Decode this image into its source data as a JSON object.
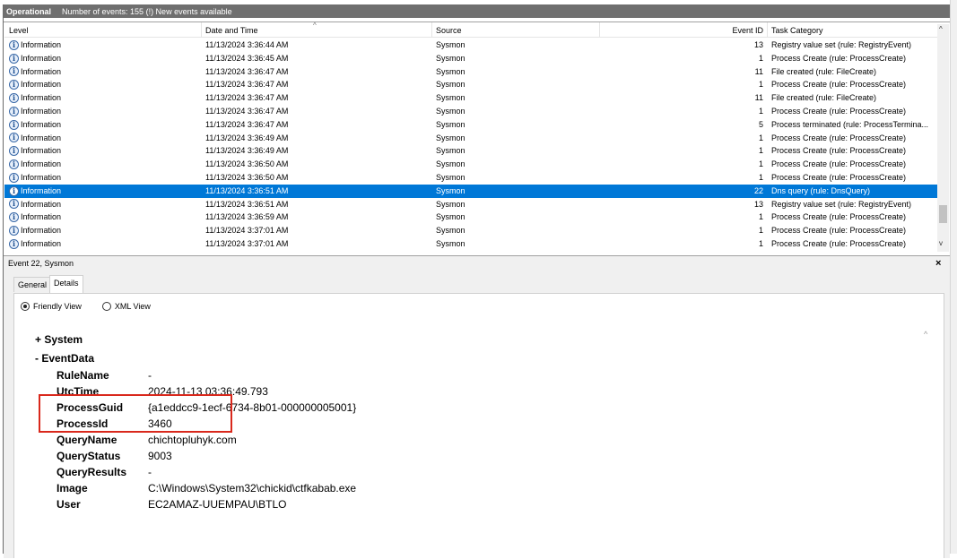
{
  "log_header": {
    "name": "Operational",
    "info": "Number of events: 155 (!) New events available"
  },
  "columns": [
    "Level",
    "Date and Time",
    "Source",
    "Event ID",
    "Task Category"
  ],
  "events": [
    {
      "level": "Information",
      "datetime": "11/13/2024 3:36:44 AM",
      "source": "Sysmon",
      "id": "13",
      "task": "Registry value set (rule: RegistryEvent)"
    },
    {
      "level": "Information",
      "datetime": "11/13/2024 3:36:45 AM",
      "source": "Sysmon",
      "id": "1",
      "task": "Process Create (rule: ProcessCreate)"
    },
    {
      "level": "Information",
      "datetime": "11/13/2024 3:36:47 AM",
      "source": "Sysmon",
      "id": "11",
      "task": "File created (rule: FileCreate)"
    },
    {
      "level": "Information",
      "datetime": "11/13/2024 3:36:47 AM",
      "source": "Sysmon",
      "id": "1",
      "task": "Process Create (rule: ProcessCreate)"
    },
    {
      "level": "Information",
      "datetime": "11/13/2024 3:36:47 AM",
      "source": "Sysmon",
      "id": "11",
      "task": "File created (rule: FileCreate)"
    },
    {
      "level": "Information",
      "datetime": "11/13/2024 3:36:47 AM",
      "source": "Sysmon",
      "id": "1",
      "task": "Process Create (rule: ProcessCreate)"
    },
    {
      "level": "Information",
      "datetime": "11/13/2024 3:36:47 AM",
      "source": "Sysmon",
      "id": "5",
      "task": "Process terminated (rule: ProcessTermina..."
    },
    {
      "level": "Information",
      "datetime": "11/13/2024 3:36:49 AM",
      "source": "Sysmon",
      "id": "1",
      "task": "Process Create (rule: ProcessCreate)"
    },
    {
      "level": "Information",
      "datetime": "11/13/2024 3:36:49 AM",
      "source": "Sysmon",
      "id": "1",
      "task": "Process Create (rule: ProcessCreate)"
    },
    {
      "level": "Information",
      "datetime": "11/13/2024 3:36:50 AM",
      "source": "Sysmon",
      "id": "1",
      "task": "Process Create (rule: ProcessCreate)"
    },
    {
      "level": "Information",
      "datetime": "11/13/2024 3:36:50 AM",
      "source": "Sysmon",
      "id": "1",
      "task": "Process Create (rule: ProcessCreate)"
    },
    {
      "level": "Information",
      "datetime": "11/13/2024 3:36:51 AM",
      "source": "Sysmon",
      "id": "22",
      "task": "Dns query (rule: DnsQuery)",
      "selected": true
    },
    {
      "level": "Information",
      "datetime": "11/13/2024 3:36:51 AM",
      "source": "Sysmon",
      "id": "13",
      "task": "Registry value set (rule: RegistryEvent)"
    },
    {
      "level": "Information",
      "datetime": "11/13/2024 3:36:59 AM",
      "source": "Sysmon",
      "id": "1",
      "task": "Process Create (rule: ProcessCreate)"
    },
    {
      "level": "Information",
      "datetime": "11/13/2024 3:37:01 AM",
      "source": "Sysmon",
      "id": "1",
      "task": "Process Create (rule: ProcessCreate)"
    },
    {
      "level": "Information",
      "datetime": "11/13/2024 3:37:01 AM",
      "source": "Sysmon",
      "id": "1",
      "task": "Process Create (rule: ProcessCreate)"
    }
  ],
  "detail": {
    "title": "Event 22, Sysmon",
    "close_glyph": "×",
    "tabs": [
      "General",
      "Details"
    ],
    "views": [
      "Friendly View",
      "XML View"
    ],
    "system_node": "+ System",
    "eventdata_node": "- EventData",
    "fields": [
      {
        "key": "RuleName",
        "value": "-"
      },
      {
        "key": "UtcTime",
        "value": "2024-11-13 03:36:49.793"
      },
      {
        "key": "ProcessGuid",
        "value": "{a1eddcc9-1ecf-6734-8b01-000000005001}"
      },
      {
        "key": "ProcessId",
        "value": "3460"
      },
      {
        "key": "QueryName",
        "value": "chichtopluhyk.com"
      },
      {
        "key": "QueryStatus",
        "value": "9003"
      },
      {
        "key": "QueryResults",
        "value": "-"
      },
      {
        "key": "Image",
        "value": "C:\\Windows\\System32\\chickid\\ctfkabab.exe"
      },
      {
        "key": "User",
        "value": "EC2AMAZ-UUEMPAU\\BTLO"
      }
    ]
  },
  "icons": {
    "info": "i",
    "scroll_up": "^",
    "scroll_down": "v"
  }
}
